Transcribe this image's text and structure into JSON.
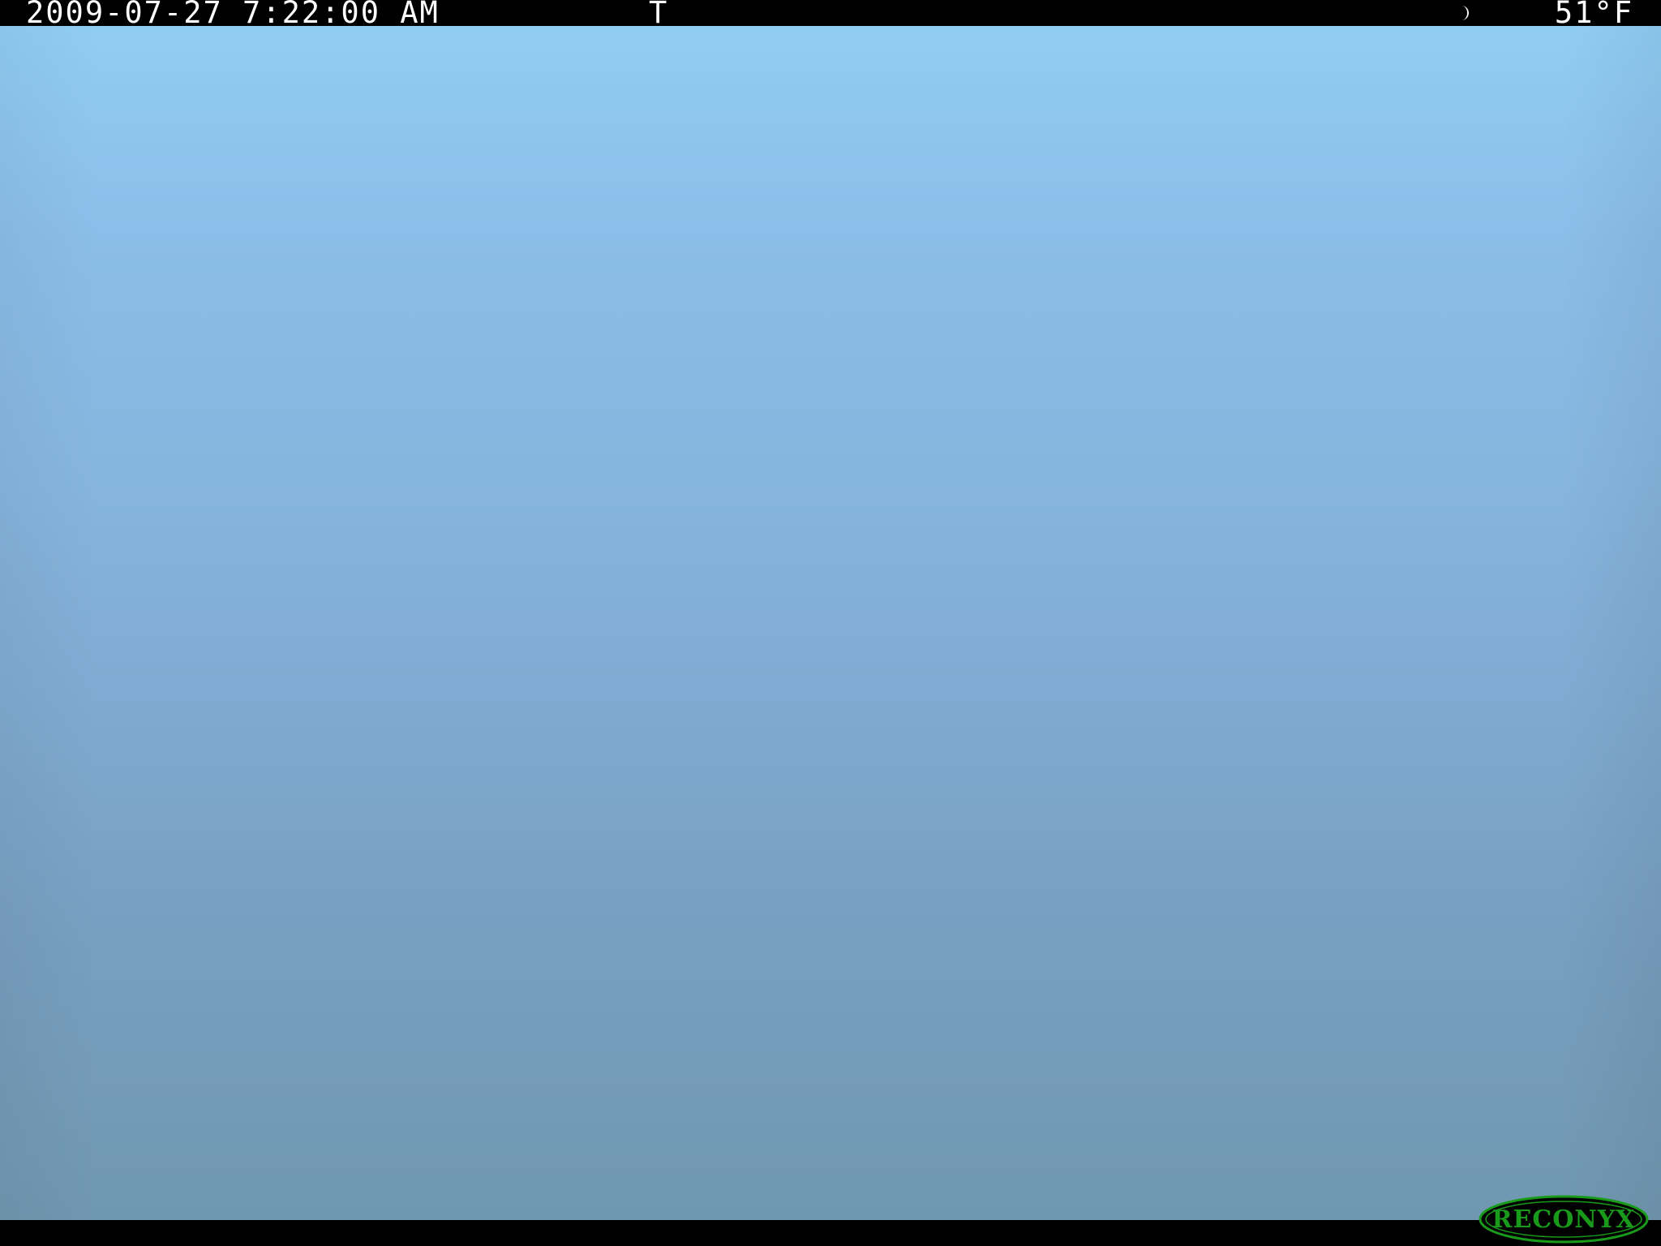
{
  "overlay": {
    "datetime": "2009-07-27 7:22:00 AM",
    "trigger": "T",
    "moon_phase_icon": "crescent-moon-icon",
    "temperature": "51°F"
  },
  "brand": {
    "logo_text": "RECONYX",
    "logo_color": "#1a9a1a"
  },
  "scene": {
    "sky_top_color": "#90cdf4",
    "sky_bottom_color": "#7097b0"
  }
}
